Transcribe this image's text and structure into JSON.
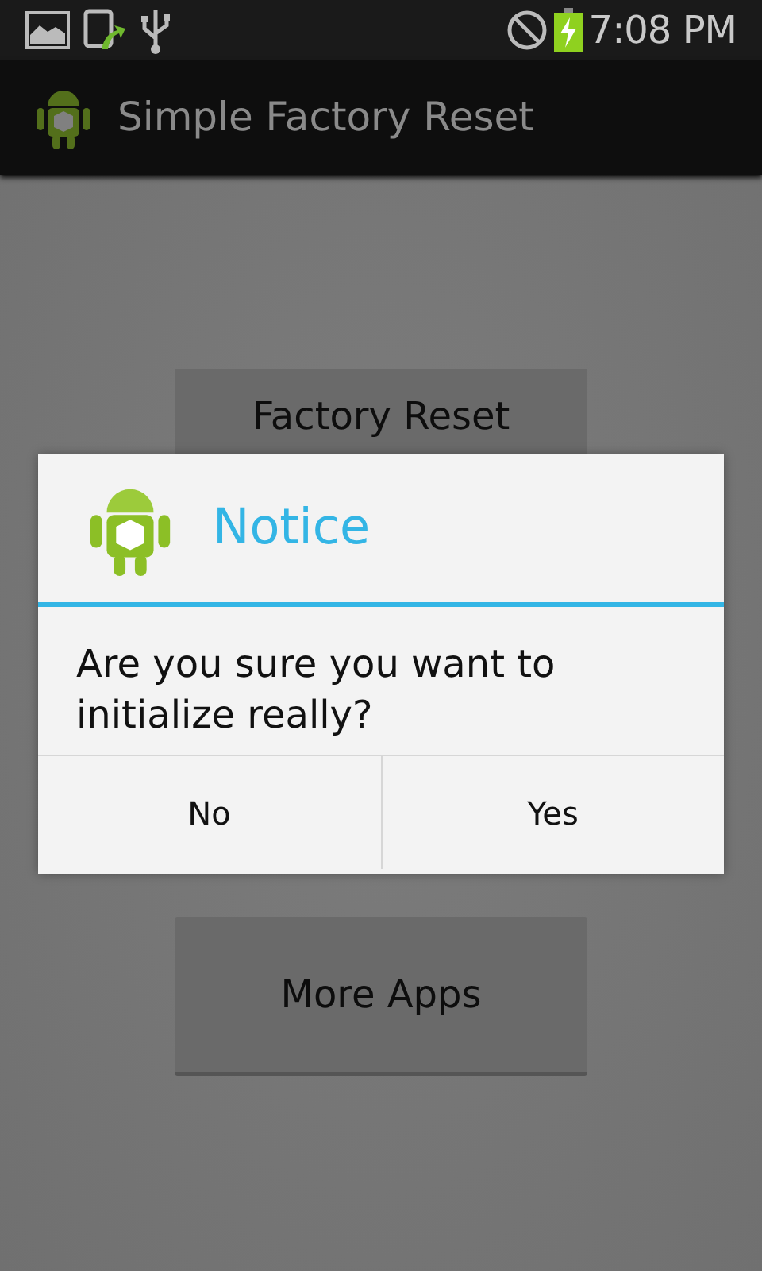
{
  "status_bar": {
    "time": "7:08 PM"
  },
  "action_bar": {
    "title": "Simple Factory Reset"
  },
  "screen_buttons": [
    {
      "label": "Factory Reset"
    },
    {
      "label": "More Apps"
    }
  ],
  "dialog": {
    "title": "Notice",
    "message": "Are you sure you want to initialize really?",
    "buttons": [
      "No",
      "Yes"
    ]
  }
}
